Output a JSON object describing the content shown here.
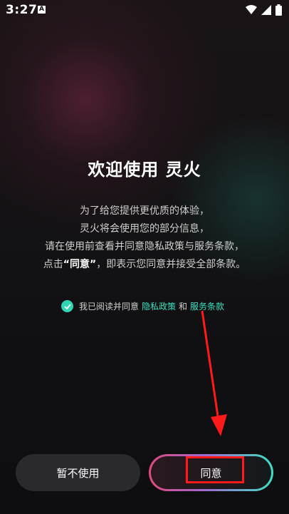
{
  "status_bar": {
    "time": "3:27",
    "notification_icon": "A"
  },
  "welcome": {
    "title": "欢迎使用 灵火",
    "line1": "为了给您提供更优质的体验，",
    "line2": "灵火将会使用您的部分信息，",
    "line3": "请在使用前查看并同意隐私政策与服务条款，",
    "line4_prefix": "点击",
    "line4_quote": "“同意”",
    "line4_suffix": "，即表示您同意并接受全部条款。"
  },
  "consent": {
    "checked": true,
    "text": "我已阅读并同意",
    "privacy_link": "隐私政策",
    "and": "和",
    "terms_link": "服务条款"
  },
  "buttons": {
    "decline": "暂不使用",
    "agree": "同意"
  },
  "colors": {
    "accent": "#37e0bd",
    "annotation": "#ff1a1a"
  }
}
